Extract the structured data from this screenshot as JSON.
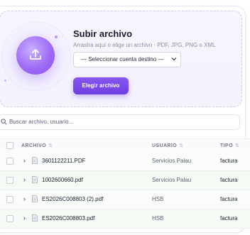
{
  "upload": {
    "title": "Subir archivo",
    "subtitle": "Arrastra aquí o elige un archivo · PDF, JPG, PNG o XML",
    "select_value": "— Seleccionar cuenta destino —",
    "button_label": "Elegir archivo",
    "accent_color": "#7b4ae8"
  },
  "search": {
    "placeholder": "Buscar archivo, usuario..."
  },
  "table": {
    "headers": {
      "archivo": "ARCHIVO",
      "usuario": "USUARIO",
      "tipo": "TIPO"
    },
    "rows": [
      {
        "archivo": "3601122211.PDF",
        "usuario": "Servicios Palau",
        "tipo": "factura"
      },
      {
        "archivo": "1002600660.pdf",
        "usuario": "Servicios Palau",
        "tipo": "factura"
      },
      {
        "archivo": "ES2026C008803 (2).pdf",
        "usuario": "HSB",
        "tipo": "factura"
      },
      {
        "archivo": "ES2026C008803.pdf",
        "usuario": "HSB",
        "tipo": "factura"
      }
    ]
  }
}
